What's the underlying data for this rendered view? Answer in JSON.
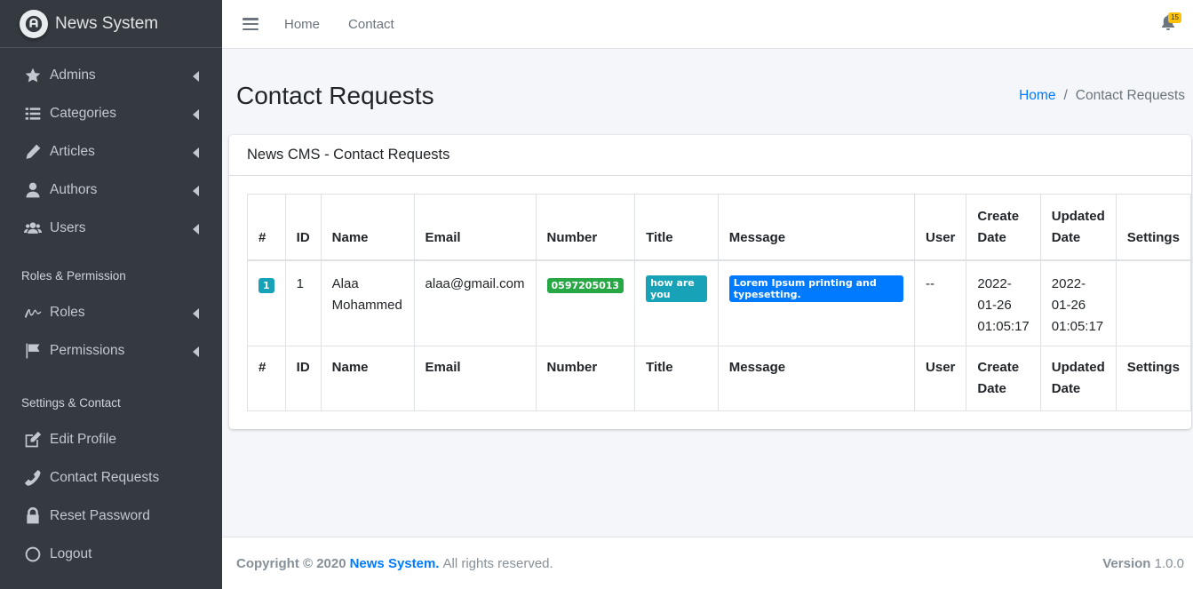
{
  "brand": {
    "name": "News System"
  },
  "sidebar": {
    "items": [
      {
        "label": "Admins",
        "icon": "star-icon"
      },
      {
        "label": "Categories",
        "icon": "list-icon"
      },
      {
        "label": "Articles",
        "icon": "pencil-icon"
      },
      {
        "label": "Authors",
        "icon": "user-icon"
      },
      {
        "label": "Users",
        "icon": "users-icon"
      }
    ],
    "section_roles": "Roles & Permission",
    "roles_items": [
      {
        "label": "Roles",
        "icon": "signature-icon"
      },
      {
        "label": "Permissions",
        "icon": "flag-icon"
      }
    ],
    "section_settings": "Settings & Contact",
    "settings_items": [
      {
        "label": "Edit Profile",
        "icon": "edit-icon"
      },
      {
        "label": "Contact Requests",
        "icon": "phone-icon"
      },
      {
        "label": "Reset Password",
        "icon": "lock-icon"
      },
      {
        "label": "Logout",
        "icon": "circle-icon"
      }
    ]
  },
  "topbar": {
    "links": [
      "Home",
      "Contact"
    ],
    "notification_count": "15"
  },
  "page": {
    "title": "Contact Requests",
    "breadcrumb": {
      "home": "Home",
      "sep": "/",
      "current": "Contact Requests"
    }
  },
  "card": {
    "title": "News CMS - Contact Requests",
    "columns": [
      "#",
      "ID",
      "Name",
      "Email",
      "Number",
      "Title",
      "Message",
      "User",
      "Create Date",
      "Updated Date",
      "Settings"
    ],
    "rows": [
      {
        "index": "1",
        "id": "1",
        "name": "Alaa Mohammed",
        "email": "alaa@gmail.com",
        "number": "0597205013",
        "title": "how are you",
        "message": "Lorem Ipsum printing and typesetting.",
        "user": "--",
        "created": "2022-01-26 01:05:17",
        "updated": "2022-01-26 01:05:17",
        "settings": ""
      }
    ]
  },
  "footer": {
    "copyright": "Copyright © 2020",
    "brand": "News System.",
    "rights": "All rights reserved.",
    "version_label": "Version",
    "version": "1.0.0"
  },
  "colors": {
    "sidebar_bg": "#343a40",
    "accent": "#007bff",
    "badge_info": "#17a2b8",
    "badge_success": "#28a745",
    "badge_warning": "#ffc107"
  }
}
